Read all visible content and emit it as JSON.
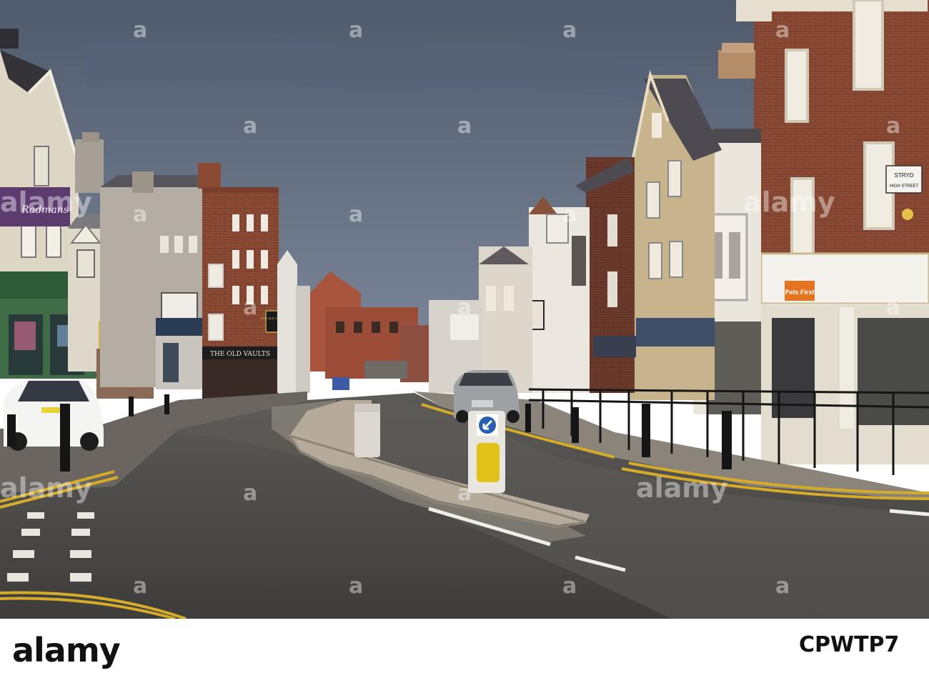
{
  "photo": {
    "description_free": true,
    "signs": {
      "radmans": "Radmans",
      "old_vaults_hanging": "THE OLD VAULTS",
      "old_vaults_fascia": "THE OLD VAULTS",
      "pets_first": "Pets First",
      "street_sign_top": "STRYD",
      "street_sign_bottom": "HIGH STREET"
    },
    "watermark_text": "alamy",
    "watermark_letter": "a"
  },
  "footer": {
    "logo": "alamy",
    "image_id": "CPWTP7"
  },
  "colors": {
    "sky": "#5f6c80",
    "road": "#4a4a4a",
    "brick": "#8a4a36",
    "sign_yellow": "#e2c21a",
    "sign_blue": "#2a5fb0"
  }
}
